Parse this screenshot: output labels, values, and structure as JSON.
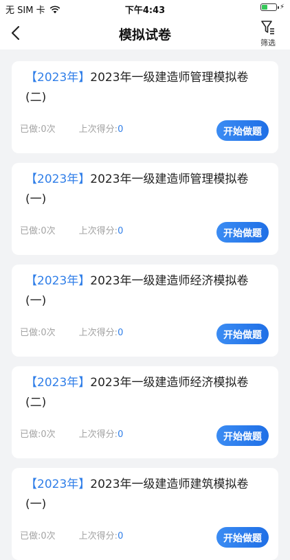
{
  "status_bar": {
    "carrier": "无 SIM 卡",
    "time": "下午4:43",
    "battery_level": 0.45
  },
  "header": {
    "title": "模拟试卷",
    "filter_label": "筛选"
  },
  "papers": [
    {
      "tag": "【2023年】",
      "title": "2023年一级建造师管理模拟卷",
      "subtitle": "(二)",
      "done_label": "已做:",
      "done_count": "0次",
      "score_label": "上次得分:",
      "score": "0",
      "button": "开始做题"
    },
    {
      "tag": "【2023年】",
      "title": "2023年一级建造师管理模拟卷",
      "subtitle": "(一)",
      "done_label": "已做:",
      "done_count": "0次",
      "score_label": "上次得分:",
      "score": "0",
      "button": "开始做题"
    },
    {
      "tag": "【2023年】",
      "title": "2023年一级建造师经济模拟卷",
      "subtitle": "(一)",
      "done_label": "已做:",
      "done_count": "0次",
      "score_label": "上次得分:",
      "score": "0",
      "button": "开始做题"
    },
    {
      "tag": "【2023年】",
      "title": "2023年一级建造师经济模拟卷",
      "subtitle": "(二)",
      "done_label": "已做:",
      "done_count": "0次",
      "score_label": "上次得分:",
      "score": "0",
      "button": "开始做题"
    },
    {
      "tag": "【2023年】",
      "title": "2023年一级建造师建筑模拟卷",
      "subtitle": "(一)",
      "done_label": "已做:",
      "done_count": "0次",
      "score_label": "上次得分:",
      "score": "0",
      "button": "开始做题"
    }
  ],
  "colors": {
    "accent": "#2f7ee8",
    "button": "#1f6fe6"
  }
}
